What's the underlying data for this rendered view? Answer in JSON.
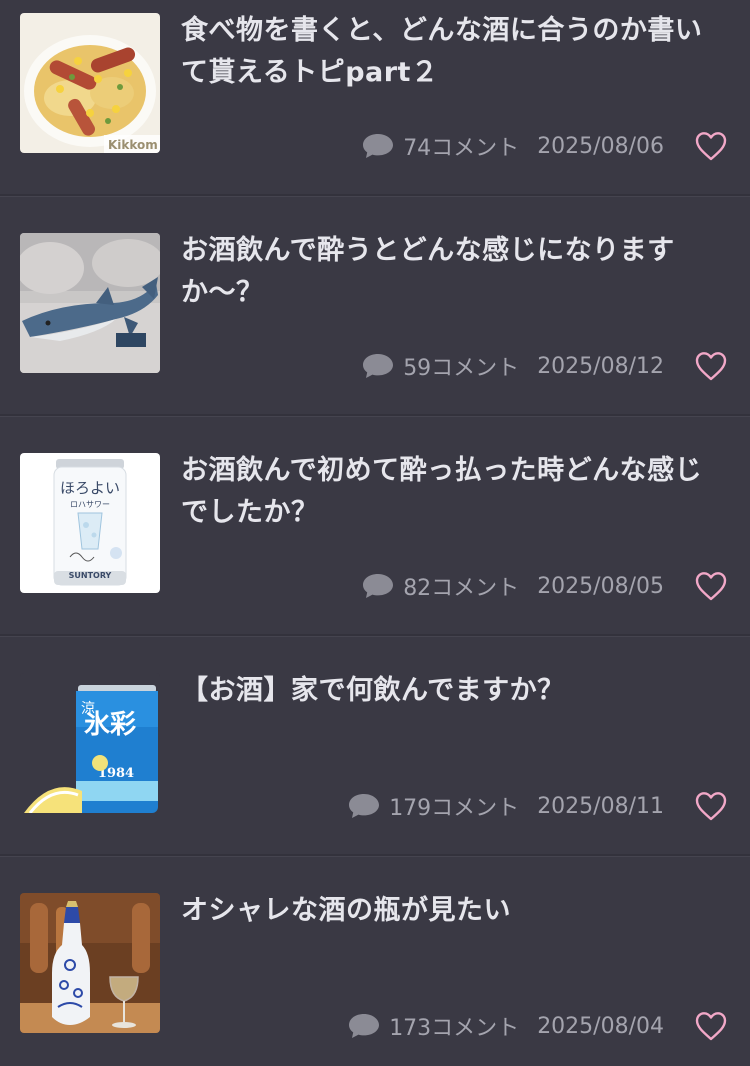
{
  "colors": {
    "background": "#3a3944",
    "title_text": "#e6e6ec",
    "meta_text": "#a4a4ae",
    "heart": "#f2a8c8"
  },
  "topics": [
    {
      "title": "食べ物を書くと、どんな酒に合うのか書いて貰えるトピpart２",
      "comments": "74コメント",
      "date": "2025/08/06",
      "thumb_icon": "food-sausage-potato-image",
      "thumb_text": "Kikkom"
    },
    {
      "title": "お酒飲んで酔うとどんな感じになりますか〜？",
      "comments": "59コメント",
      "date": "2025/08/12",
      "thumb_icon": "shark-plush-on-sofa-image"
    },
    {
      "title": "お酒飲んで初めて酔っ払った時どんな感じでしたか？",
      "comments": "82コメント",
      "date": "2025/08/05",
      "thumb_icon": "horoyoi-can-image",
      "thumb_text_1": "ほろよい",
      "thumb_text_2": "ロハサワー",
      "thumb_text_3": "SUNTORY"
    },
    {
      "title": "【お酒】家で何飲んでますか？",
      "comments": "179コメント",
      "date": "2025/08/11",
      "thumb_icon": "hyoketsu-can-image",
      "thumb_text_1": "氷彩",
      "thumb_text_2": "1984",
      "thumb_text_3": "涼"
    },
    {
      "title": "オシャレな酒の瓶が見たい",
      "comments": "173コメント",
      "date": "2025/08/04",
      "thumb_icon": "decorative-bottle-image"
    }
  ]
}
